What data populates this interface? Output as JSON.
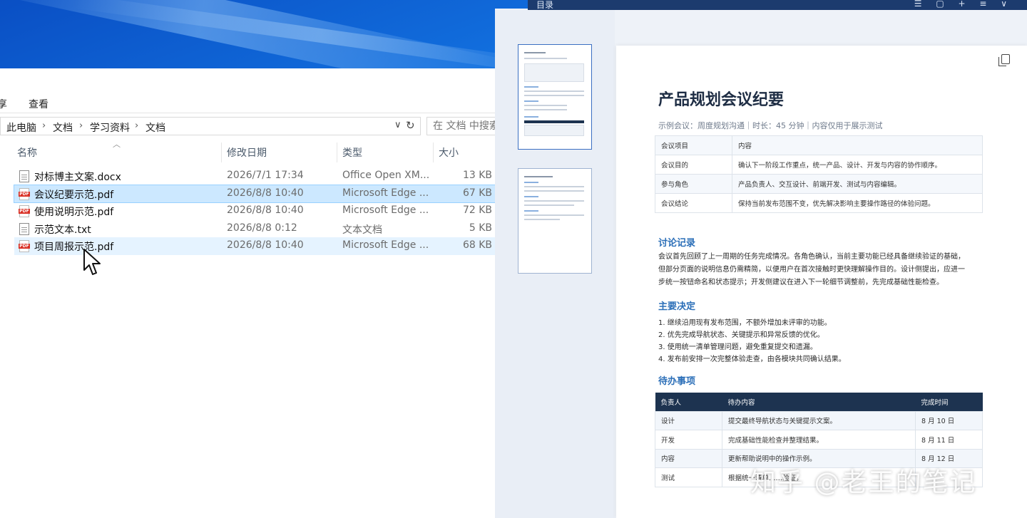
{
  "explorer": {
    "ribbon_tabs": [
      "享",
      "查看"
    ],
    "breadcrumbs": [
      "此电脑",
      "文档",
      "学习资料",
      "文档"
    ],
    "search_placeholder": "在 文档 中搜索",
    "columns": {
      "name": "名称",
      "date": "修改日期",
      "type": "类型",
      "size": "大小"
    },
    "files": [
      {
        "name": "对标博主文案.docx",
        "date": "2026/7/1 17:34",
        "type": "Office Open XM...",
        "size": "13 KB",
        "icon": "doc-file-icon",
        "state": "normal"
      },
      {
        "name": "会议纪要示范.pdf",
        "date": "2026/8/8 10:40",
        "type": "Microsoft Edge ...",
        "size": "67 KB",
        "icon": "pdf-file-icon",
        "state": "selected"
      },
      {
        "name": "使用说明示范.pdf",
        "date": "2026/8/8 10:40",
        "type": "Microsoft Edge ...",
        "size": "72 KB",
        "icon": "pdf-file-icon",
        "state": "normal"
      },
      {
        "name": "示范文本.txt",
        "date": "2026/8/8 0:12",
        "type": "文本文档",
        "size": "5 KB",
        "icon": "txt-file-icon",
        "state": "normal"
      },
      {
        "name": "项目周报示范.pdf",
        "date": "2026/8/8 10:40",
        "type": "Microsoft Edge ...",
        "size": "68 KB",
        "icon": "pdf-file-icon",
        "state": "hover"
      }
    ]
  },
  "viewer": {
    "toc_label": "目录",
    "toolbar_icons": "☰ ▢ + ≡ ∨",
    "title": "产品规划会议纪要",
    "subtitle": "示例会议：周度规划沟通｜时长：45 分钟｜内容仅用于展示测试",
    "info_table": [
      [
        "会议项目",
        "内容"
      ],
      [
        "会议目的",
        "确认下一阶段工作重点，统一产品、设计、开发与内容的协作顺序。"
      ],
      [
        "参与角色",
        "产品负责人、交互设计、前端开发、测试与内容编辑。"
      ],
      [
        "会议结论",
        "保持当前发布范围不变，优先解决影响主要操作路径的体验问题。"
      ]
    ],
    "sections": {
      "discussion": "讨论记录",
      "decisions": "主要决定",
      "todos": "待办事项"
    },
    "discussion_lines": [
      "会议首先回顾了上一周期的任务完成情况。各角色确认，当前主要功能已经具备继续验证的基础，",
      "但部分页面的说明信息仍需精简，以便用户在首次接触时更快理解操作目的。设计侧提出，应进一",
      "步统一按钮命名和状态提示；开发侧建议在进入下一轮细节调整前，先完成基础性能检查。"
    ],
    "decisions_list": [
      "1. 继续沿用现有发布范围，不额外增加未评审的功能。",
      "2. 优先完成导航状态、关键提示和异常反馈的优化。",
      "3. 使用统一清单管理问题，避免重复提交和遗漏。",
      "4. 发布前安排一次完整体验走查，由各模块共同确认结果。"
    ],
    "todo_headers": [
      "负责人",
      "待办内容",
      "完成时间"
    ],
    "todo_rows": [
      [
        "设计",
        "提交最终导航状态与关键提示文案。",
        "8 月 10 日"
      ],
      [
        "开发",
        "完成基础性能检查并整理结果。",
        "8 月 11 日"
      ],
      [
        "内容",
        "更新帮助说明中的操作示例。",
        "8 月 12 日"
      ],
      [
        "测试",
        "根据统一清单……验证。",
        ""
      ]
    ]
  },
  "watermark": "知乎 @老王的笔记"
}
